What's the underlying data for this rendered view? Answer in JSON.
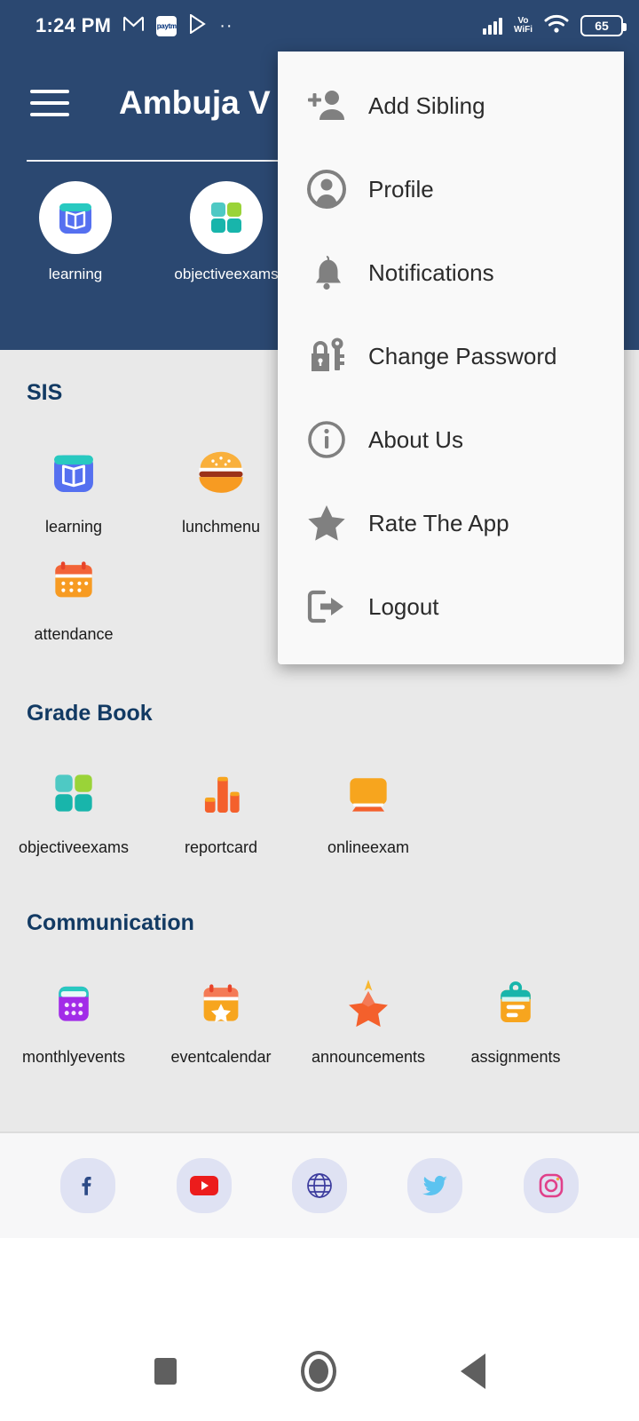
{
  "status_bar": {
    "time": "1:24 PM",
    "icons_left": [
      "gmail-icon",
      "paytm-icon",
      "play-store-icon",
      "more-dots-icon"
    ],
    "network_label": "Vo",
    "network_label2": "WiFi",
    "battery_percent": "65",
    "icons_right": [
      "signal-icon",
      "volte-wifi-icon",
      "wifi-icon",
      "battery-icon"
    ]
  },
  "app_bar": {
    "menu_icon": "hamburger-icon",
    "title": "Ambuja V",
    "shortcuts": [
      {
        "label": "learning",
        "icon": "book-icon"
      },
      {
        "label": "objectiveexams",
        "icon": "grid-squares-icon"
      }
    ],
    "page_dots": 2
  },
  "overflow_menu": {
    "items": [
      {
        "label": "Add Sibling",
        "icon": "person-add-icon"
      },
      {
        "label": "Profile",
        "icon": "account-circle-icon"
      },
      {
        "label": "Notifications",
        "icon": "bell-icon"
      },
      {
        "label": "Change Password",
        "icon": "lock-key-icon"
      },
      {
        "label": "About Us",
        "icon": "info-circle-icon"
      },
      {
        "label": "Rate The App",
        "icon": "star-icon"
      },
      {
        "label": "Logout",
        "icon": "logout-arrow-icon"
      }
    ]
  },
  "sections": [
    {
      "title": "SIS",
      "tiles": [
        {
          "label": "learning",
          "icon": "book-icon"
        },
        {
          "label": "lunchmenu",
          "icon": "burger-icon"
        },
        {
          "label": "attendance",
          "icon": "calendar-icon"
        }
      ]
    },
    {
      "title": "Grade Book",
      "tiles": [
        {
          "label": "objectiveexams",
          "icon": "grid-squares-icon"
        },
        {
          "label": "reportcard",
          "icon": "bar-chart-icon"
        },
        {
          "label": "onlineexam",
          "icon": "monitor-icon"
        }
      ]
    },
    {
      "title": "Communication",
      "tiles": [
        {
          "label": "monthlyevents",
          "icon": "purple-calendar-icon"
        },
        {
          "label": "eventcalendar",
          "icon": "calendar-star-icon"
        },
        {
          "label": "announcements",
          "icon": "star-burst-icon"
        },
        {
          "label": "assignments",
          "icon": "clipboard-icon"
        }
      ]
    }
  ],
  "social_bar": {
    "items": [
      {
        "name": "facebook-icon"
      },
      {
        "name": "youtube-icon"
      },
      {
        "name": "website-globe-icon"
      },
      {
        "name": "twitter-icon"
      },
      {
        "name": "instagram-icon"
      }
    ]
  },
  "nav_bar": {
    "items": [
      {
        "name": "recents-button"
      },
      {
        "name": "home-button"
      },
      {
        "name": "back-button"
      }
    ]
  },
  "colors": {
    "header_navy": "#2b4871",
    "body_gray": "#e9e9e9",
    "section_title": "#123a63",
    "menu_bg": "#f9f9f9",
    "menu_icon": "#808080"
  }
}
